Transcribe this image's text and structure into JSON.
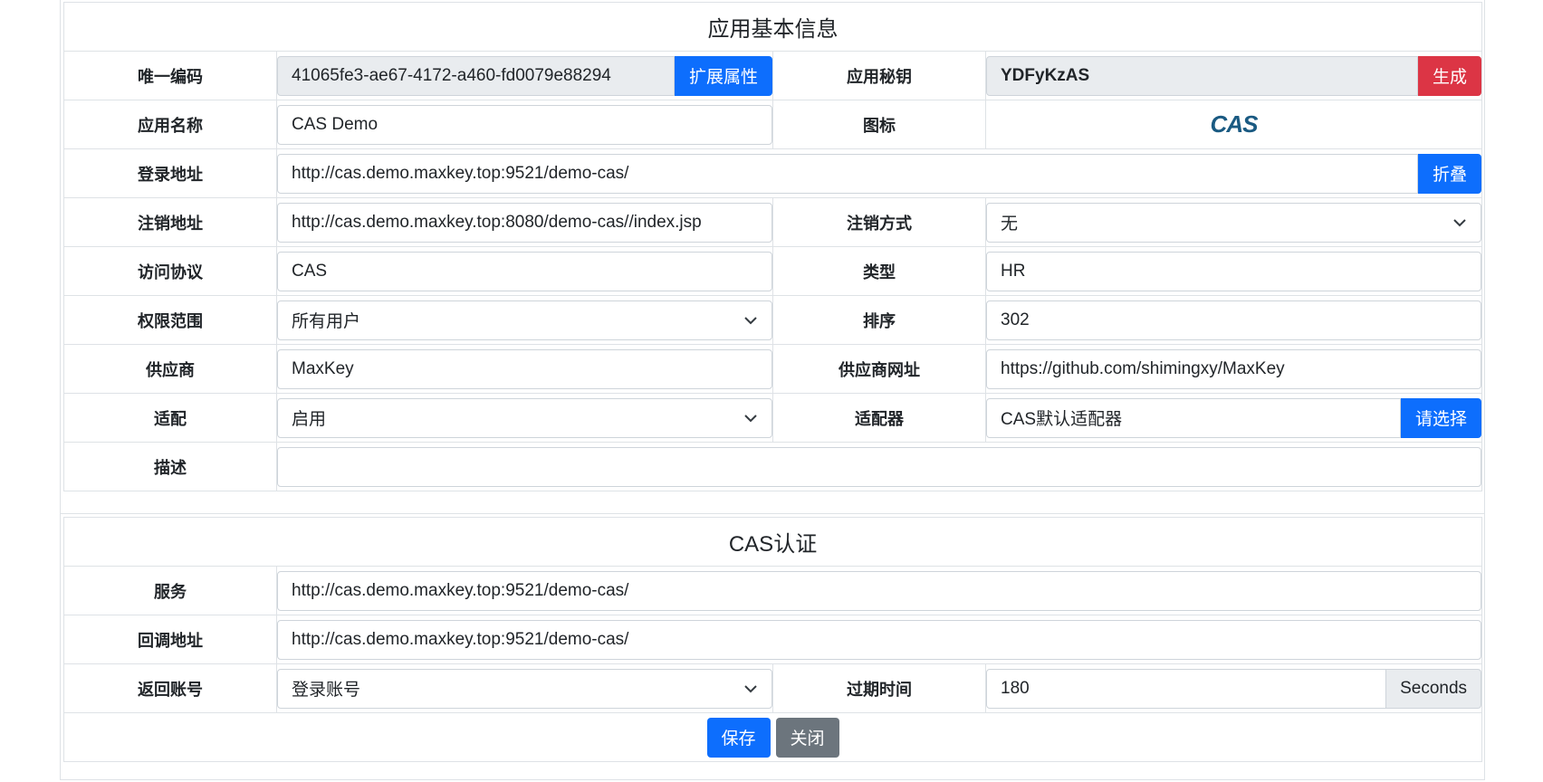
{
  "basic": {
    "caption": "应用基本信息",
    "uid_label": "唯一编码",
    "uid_value": "41065fe3-ae67-4172-a460-fd0079e88294",
    "ext_btn": "扩展属性",
    "secret_label": "应用秘钥",
    "secret_value": "YDFyKzAS",
    "gen_btn": "生成",
    "name_label": "应用名称",
    "name_value": "CAS Demo",
    "icon_label": "图标",
    "icon_text": "CAS",
    "login_label": "登录地址",
    "login_value": "http://cas.demo.maxkey.top:9521/demo-cas/",
    "fold_btn": "折叠",
    "logout_label": "注销地址",
    "logout_value": "http://cas.demo.maxkey.top:8080/demo-cas//index.jsp",
    "logout_type_label": "注销方式",
    "logout_type_value": "无",
    "protocol_label": "访问协议",
    "protocol_value": "CAS",
    "type_label": "类型",
    "type_value": "HR",
    "scope_label": "权限范围",
    "scope_value": "所有用户",
    "order_label": "排序",
    "order_value": "302",
    "vendor_label": "供应商",
    "vendor_value": "MaxKey",
    "vendor_url_label": "供应商网址",
    "vendor_url_value": "https://github.com/shimingxy/MaxKey",
    "adapt_label": "适配",
    "adapt_value": "启用",
    "adapter_label": "适配器",
    "adapter_value": "CAS默认适配器",
    "choose_btn": "请选择",
    "desc_label": "描述",
    "desc_value": ""
  },
  "cas": {
    "caption": "CAS认证",
    "service_label": "服务",
    "service_value": "http://cas.demo.maxkey.top:9521/demo-cas/",
    "callback_label": "回调地址",
    "callback_value": "http://cas.demo.maxkey.top:9521/demo-cas/",
    "account_label": "返回账号",
    "account_value": "登录账号",
    "expire_label": "过期时间",
    "expire_value": "180",
    "expire_unit": "Seconds"
  },
  "actions": {
    "save": "保存",
    "close": "关闭"
  },
  "colors": {
    "primary": "#0d6efd",
    "danger": "#dc3545",
    "secondary": "#6c757d"
  }
}
